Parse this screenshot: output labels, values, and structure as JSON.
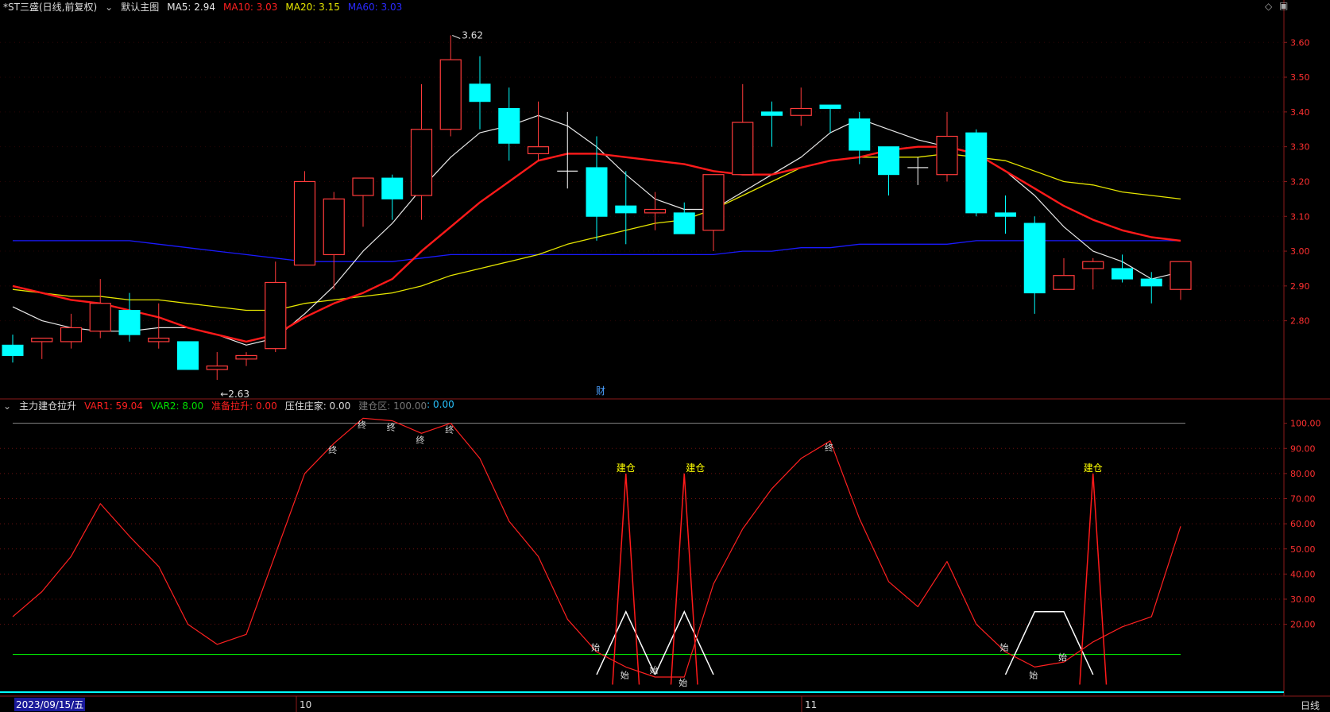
{
  "main_header": {
    "symbol": "*ST三盛(日线,前复权)",
    "indicator": "默认主图",
    "ma5": "MA5: 2.94",
    "ma10": "MA10: 3.03",
    "ma20": "MA20: 3.15",
    "ma60": "MA60: 3.03"
  },
  "sub_header": {
    "name": "主力建仓拉升",
    "var1": "VAR1: 59.04",
    "var2": "VAR2: 8.00",
    "lashen": "准备拉升: 0.00",
    "yazhu": "压住庄家: 0.00",
    "jiancang_zone": "建仓区: 100.00",
    "jiancang_val": ": 0.00"
  },
  "markers": {
    "high": "3.62",
    "low": "2.63",
    "cai": "财",
    "zhong": "终",
    "shi": "始",
    "jiancang": "建仓"
  },
  "footer": {
    "date": "2023/09/15/五",
    "period": "日线",
    "month_oct": "10",
    "month_nov": "11"
  },
  "colors": {
    "up": "#ff3b3b",
    "down": "#00ffff",
    "ma5": "#e8e8e8",
    "ma10": "#ff1a1a",
    "ma20": "#e6e600",
    "ma60": "#1a1aff",
    "var1": "#ff2020",
    "var2": "#00e000"
  },
  "chart_data": [
    {
      "type": "candlestick",
      "title": "",
      "yticks": [
        "3.60",
        "3.50",
        "3.40",
        "3.30",
        "3.20",
        "3.10",
        "3.00",
        "2.90",
        "2.80"
      ],
      "ylim": [
        2.58,
        3.66
      ],
      "candles": [
        {
          "o": 2.73,
          "h": 2.76,
          "l": 2.68,
          "c": 2.7
        },
        {
          "o": 2.74,
          "h": 2.75,
          "l": 2.69,
          "c": 2.75
        },
        {
          "o": 2.74,
          "h": 2.82,
          "l": 2.72,
          "c": 2.78
        },
        {
          "o": 2.77,
          "h": 2.92,
          "l": 2.75,
          "c": 2.85
        },
        {
          "o": 2.83,
          "h": 2.88,
          "l": 2.74,
          "c": 2.76
        },
        {
          "o": 2.74,
          "h": 2.85,
          "l": 2.72,
          "c": 2.75
        },
        {
          "o": 2.74,
          "h": 2.74,
          "l": 2.66,
          "c": 2.66
        },
        {
          "o": 2.66,
          "h": 2.71,
          "l": 2.63,
          "c": 2.67
        },
        {
          "o": 2.69,
          "h": 2.71,
          "l": 2.67,
          "c": 2.7
        },
        {
          "o": 2.72,
          "h": 2.97,
          "l": 2.71,
          "c": 2.91
        },
        {
          "o": 2.96,
          "h": 3.23,
          "l": 2.96,
          "c": 3.2
        },
        {
          "o": 2.99,
          "h": 3.17,
          "l": 2.89,
          "c": 3.15
        },
        {
          "o": 3.16,
          "h": 3.21,
          "l": 3.07,
          "c": 3.21
        },
        {
          "o": 3.21,
          "h": 3.22,
          "l": 3.09,
          "c": 3.15
        },
        {
          "o": 3.16,
          "h": 3.48,
          "l": 3.09,
          "c": 3.35
        },
        {
          "o": 3.35,
          "h": 3.62,
          "l": 3.33,
          "c": 3.55
        },
        {
          "o": 3.48,
          "h": 3.56,
          "l": 3.35,
          "c": 3.43
        },
        {
          "o": 3.41,
          "h": 3.47,
          "l": 3.26,
          "c": 3.31
        },
        {
          "o": 3.28,
          "h": 3.43,
          "l": 3.26,
          "c": 3.3
        },
        {
          "o": 3.23,
          "h": 3.4,
          "l": 3.18,
          "c": 3.23
        },
        {
          "o": 3.24,
          "h": 3.33,
          "l": 3.03,
          "c": 3.1
        },
        {
          "o": 3.13,
          "h": 3.23,
          "l": 3.02,
          "c": 3.11
        },
        {
          "o": 3.11,
          "h": 3.17,
          "l": 3.06,
          "c": 3.12
        },
        {
          "o": 3.11,
          "h": 3.14,
          "l": 3.05,
          "c": 3.05
        },
        {
          "o": 3.06,
          "h": 3.22,
          "l": 3.0,
          "c": 3.22
        },
        {
          "o": 3.22,
          "h": 3.48,
          "l": 3.22,
          "c": 3.37
        },
        {
          "o": 3.4,
          "h": 3.43,
          "l": 3.3,
          "c": 3.39
        },
        {
          "o": 3.39,
          "h": 3.47,
          "l": 3.36,
          "c": 3.41
        },
        {
          "o": 3.42,
          "h": 3.42,
          "l": 3.34,
          "c": 3.41
        },
        {
          "o": 3.38,
          "h": 3.4,
          "l": 3.25,
          "c": 3.29
        },
        {
          "o": 3.3,
          "h": 3.3,
          "l": 3.16,
          "c": 3.22
        },
        {
          "o": 3.24,
          "h": 3.27,
          "l": 3.19,
          "c": 3.24
        },
        {
          "o": 3.22,
          "h": 3.4,
          "l": 3.2,
          "c": 3.33
        },
        {
          "o": 3.34,
          "h": 3.35,
          "l": 3.1,
          "c": 3.11
        },
        {
          "o": 3.11,
          "h": 3.16,
          "l": 3.05,
          "c": 3.1
        },
        {
          "o": 3.08,
          "h": 3.1,
          "l": 2.82,
          "c": 2.88
        },
        {
          "o": 2.89,
          "h": 2.98,
          "l": 2.89,
          "c": 2.93
        },
        {
          "o": 2.95,
          "h": 2.98,
          "l": 2.89,
          "c": 2.97
        },
        {
          "o": 2.95,
          "h": 2.99,
          "l": 2.91,
          "c": 2.92
        },
        {
          "o": 2.92,
          "h": 2.94,
          "l": 2.85,
          "c": 2.9
        },
        {
          "o": 2.89,
          "h": 2.97,
          "l": 2.86,
          "c": 2.97
        }
      ],
      "ma5": [
        2.84,
        2.8,
        2.78,
        2.77,
        2.77,
        2.78,
        2.78,
        2.76,
        2.73,
        2.75,
        2.82,
        2.9,
        3.0,
        3.08,
        3.18,
        3.27,
        3.34,
        3.36,
        3.39,
        3.36,
        3.3,
        3.22,
        3.15,
        3.12,
        3.12,
        3.17,
        3.22,
        3.27,
        3.34,
        3.38,
        3.35,
        3.32,
        3.3,
        3.28,
        3.23,
        3.16,
        3.07,
        3.0,
        2.97,
        2.92,
        2.94
      ],
      "ma10": [
        2.9,
        2.88,
        2.86,
        2.85,
        2.83,
        2.81,
        2.78,
        2.76,
        2.74,
        2.76,
        2.81,
        2.85,
        2.88,
        2.92,
        3.0,
        3.07,
        3.14,
        3.2,
        3.26,
        3.28,
        3.28,
        3.27,
        3.26,
        3.25,
        3.23,
        3.22,
        3.22,
        3.24,
        3.26,
        3.27,
        3.29,
        3.3,
        3.3,
        3.28,
        3.23,
        3.18,
        3.13,
        3.09,
        3.06,
        3.04,
        3.03
      ],
      "ma20": [
        2.89,
        2.88,
        2.87,
        2.87,
        2.86,
        2.86,
        2.85,
        2.84,
        2.83,
        2.83,
        2.85,
        2.86,
        2.87,
        2.88,
        2.9,
        2.93,
        2.95,
        2.97,
        2.99,
        3.02,
        3.04,
        3.06,
        3.08,
        3.09,
        3.12,
        3.16,
        3.2,
        3.24,
        3.26,
        3.27,
        3.27,
        3.27,
        3.28,
        3.27,
        3.26,
        3.23,
        3.2,
        3.19,
        3.17,
        3.16,
        3.15
      ],
      "ma60": [
        3.03,
        3.03,
        3.03,
        3.03,
        3.03,
        3.02,
        3.01,
        3.0,
        2.99,
        2.98,
        2.97,
        2.97,
        2.97,
        2.97,
        2.98,
        2.99,
        2.99,
        2.99,
        2.99,
        2.99,
        2.99,
        2.99,
        2.99,
        2.99,
        2.99,
        3.0,
        3.0,
        3.01,
        3.01,
        3.02,
        3.02,
        3.02,
        3.02,
        3.03,
        3.03,
        3.03,
        3.03,
        3.03,
        3.03,
        3.03,
        3.03
      ]
    },
    {
      "type": "line",
      "title": "",
      "yticks": [
        "100.00",
        "90.00",
        "80.00",
        "70.00",
        "60.00",
        "50.00",
        "40.00",
        "30.00",
        "20.00"
      ],
      "ylim": [
        -7,
        104
      ],
      "series": [
        {
          "name": "VAR1",
          "values": [
            23,
            33,
            47,
            68,
            55,
            43,
            20,
            12,
            16,
            48,
            80,
            92,
            102,
            101,
            96,
            100,
            86,
            61,
            47,
            22,
            9,
            3,
            -1,
            -1,
            36,
            58,
            74,
            86,
            93,
            62,
            37,
            27,
            45,
            20,
            9,
            3,
            5,
            13,
            19,
            23,
            59
          ]
        },
        {
          "name": "VAR2",
          "values": [
            8,
            8,
            8,
            8,
            8,
            8,
            8,
            8,
            8,
            8,
            8,
            8,
            8,
            8,
            8,
            8,
            8,
            8,
            8,
            8,
            8,
            8,
            8,
            8,
            8,
            8,
            8,
            8,
            8,
            8,
            8,
            8,
            8,
            8,
            8,
            8,
            8,
            8,
            8,
            8,
            8
          ]
        }
      ],
      "white_shapes": [
        [
          [
            20,
            0
          ],
          [
            21,
            25
          ],
          [
            22,
            0
          ]
        ],
        [
          [
            22,
            0
          ],
          [
            23,
            25
          ],
          [
            24,
            0
          ]
        ],
        [
          [
            34,
            0
          ],
          [
            35,
            25
          ],
          [
            36,
            25
          ],
          [
            37,
            0
          ]
        ]
      ],
      "red_spikes": [
        21,
        23,
        37
      ],
      "zhong_points": [
        11,
        12,
        13,
        14,
        15,
        28
      ],
      "shi_points": [
        20,
        21,
        22,
        23,
        34,
        35,
        36
      ],
      "jiancang_points": [
        22,
        24,
        37
      ]
    }
  ]
}
